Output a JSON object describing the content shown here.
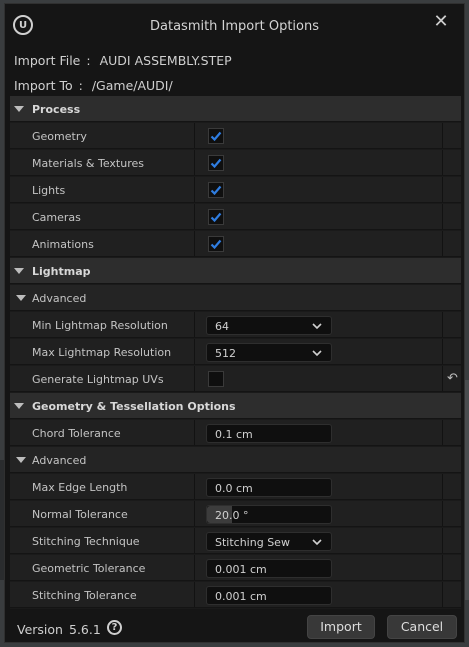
{
  "window": {
    "title": "Datasmith Import Options",
    "logo_text": "U"
  },
  "info": {
    "import_file_label": "Import File",
    "import_file_value": "AUDI ASSEMBLY.STEP",
    "import_to_label": "Import To",
    "import_to_value": "/Game/AUDI/",
    "separator": ":"
  },
  "sections": {
    "process": "Process",
    "lightmap": "Lightmap",
    "lightmap_advanced": "Advanced",
    "tessellation": "Geometry & Tessellation Options",
    "tessellation_advanced": "Advanced"
  },
  "process": [
    {
      "label": "Geometry",
      "checked": true
    },
    {
      "label": "Materials & Textures",
      "checked": true
    },
    {
      "label": "Lights",
      "checked": true
    },
    {
      "label": "Cameras",
      "checked": true
    },
    {
      "label": "Animations",
      "checked": true
    }
  ],
  "lightmap": {
    "min_res_label": "Min Lightmap Resolution",
    "min_res_value": "64",
    "max_res_label": "Max Lightmap Resolution",
    "max_res_value": "512",
    "gen_uvs_label": "Generate Lightmap UVs",
    "gen_uvs_checked": false
  },
  "tessellation": {
    "chord_label": "Chord Tolerance",
    "chord_value": "0.1 cm",
    "max_edge_label": "Max Edge Length",
    "max_edge_value": "0.0 cm",
    "normal_label": "Normal Tolerance",
    "normal_value": "20.0 °",
    "normal_fraction": 0.2,
    "stitching_label": "Stitching Technique",
    "stitching_value": "Stitching Sew",
    "geom_tol_label": "Geometric Tolerance",
    "geom_tol_value": "0.001 cm",
    "stitch_tol_label": "Stitching Tolerance",
    "stitch_tol_value": "0.001 cm"
  },
  "footer": {
    "version_label": "Version",
    "version_value": "5.6.1",
    "help_glyph": "?",
    "import_label": "Import",
    "cancel_label": "Cancel"
  },
  "colors": {
    "accent_check": "#2f7de1",
    "dialog_bg": "#151515"
  }
}
